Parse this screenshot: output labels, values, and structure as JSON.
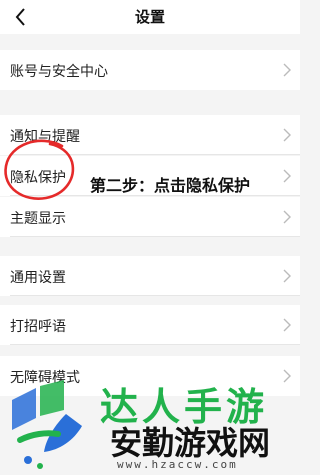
{
  "header": {
    "title": "设置",
    "back_icon": "chevron-left-icon"
  },
  "settings": {
    "account_security": "账号与安全中心",
    "notifications": "通知与提醒",
    "privacy": "隐私保护",
    "theme": "主题显示",
    "general": "通用设置",
    "greeting": "打招呼语",
    "obscured_row": "无障碍模式",
    "chevron_icon": "chevron-right-icon"
  },
  "annotation": {
    "text": "第二步：点击隐私保护",
    "circle_color": "#e52a2a"
  },
  "watermark": {
    "top_text": "达人手游",
    "brand_text": "安勤游戏网",
    "url": "www.hzaccw.com",
    "green": "#22b24c",
    "blue": "#2a6fd8"
  }
}
